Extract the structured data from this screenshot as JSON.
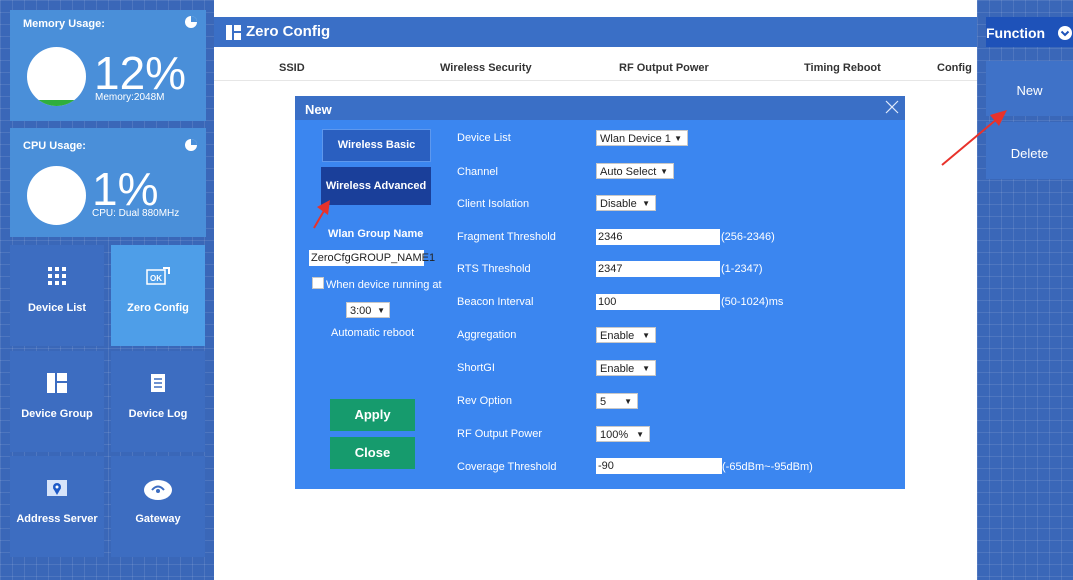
{
  "memory": {
    "title": "Memory Usage:",
    "percent": "12%",
    "sub": "Memory:2048M",
    "fraction": 0.12
  },
  "cpu": {
    "title": "CPU Usage:",
    "percent": "1%",
    "sub": "CPU: Dual 880MHz",
    "fraction": 0.01
  },
  "nav": [
    {
      "label": "Device List",
      "icon": "grid-icon"
    },
    {
      "label": "Zero Config",
      "icon": "ok-tag-icon"
    },
    {
      "label": "Device Group",
      "icon": "group-icon"
    },
    {
      "label": "Device Log",
      "icon": "log-icon"
    },
    {
      "label": "Address Server",
      "icon": "map-pin-icon"
    },
    {
      "label": "Gateway",
      "icon": "gateway-icon"
    }
  ],
  "page_title": "Zero Config",
  "columns": [
    "SSID",
    "Wireless Security",
    "RF Output Power",
    "Timing Reboot",
    "Config"
  ],
  "function_panel": {
    "title": "Function",
    "new_label": "New",
    "delete_label": "Delete"
  },
  "dialog": {
    "title": "New",
    "wireless_basic": "Wireless Basic",
    "wireless_advanced": "Wireless Advanced",
    "wlan_group_label": "Wlan Group Name",
    "wlan_group_value": "ZeroCfgGROUP_NAME1",
    "running_checkbox_label": "When device running at",
    "time_value": "3:00",
    "auto_reboot": "Automatic reboot",
    "apply": "Apply",
    "close": "Close",
    "fields": {
      "device_list": {
        "label": "Device List",
        "value": "Wlan Device 1"
      },
      "channel": {
        "label": "Channel",
        "value": "Auto Select"
      },
      "client_isolation": {
        "label": "Client Isolation",
        "value": "Disable"
      },
      "fragment_threshold": {
        "label": "Fragment Threshold",
        "value": "2346",
        "range": "(256-2346)"
      },
      "rts_threshold": {
        "label": "RTS Threshold",
        "value": "2347",
        "range": "(1-2347)"
      },
      "beacon_interval": {
        "label": "Beacon Interval",
        "value": "100",
        "range": "(50-1024)ms"
      },
      "aggregation": {
        "label": "Aggregation",
        "value": "Enable"
      },
      "shortgi": {
        "label": "ShortGI",
        "value": "Enable"
      },
      "rev_option": {
        "label": "Rev Option",
        "value": "5"
      },
      "rf_output_power": {
        "label": "RF Output Power",
        "value": "100%"
      },
      "coverage_threshold": {
        "label": "Coverage Threshold",
        "value": "-90",
        "range": "(-65dBm~-95dBm)"
      }
    }
  },
  "colors": {
    "accent_dark": "#1a3f9a",
    "apply_green": "#169b6d",
    "dialog_blue": "#3b86f0",
    "annotation_red": "#e8322b"
  }
}
